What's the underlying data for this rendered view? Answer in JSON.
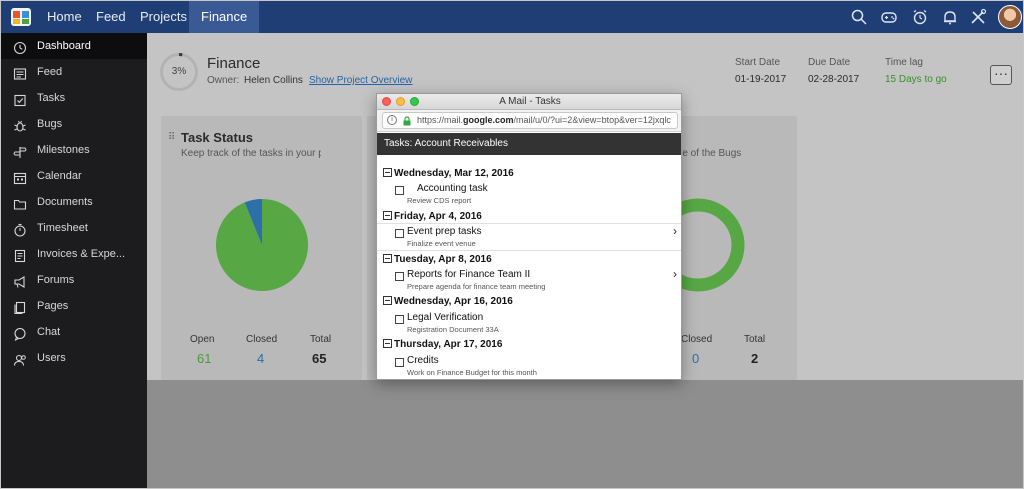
{
  "colors": {
    "topbar": "#1f3e75",
    "sidebar": "#1c1c1e",
    "open": "#4e9a3a",
    "closed": "#2a6ea8",
    "accent_green": "#3a8f2d"
  },
  "topnav": {
    "items": [
      "Home",
      "Feed",
      "Projects",
      "Finance"
    ],
    "active": "Finance",
    "icons": [
      "search-icon",
      "gamepad-icon",
      "alarm-icon",
      "bell-icon",
      "tools-icon"
    ]
  },
  "sidebar": {
    "items": [
      {
        "label": "Dashboard",
        "icon": "clock-icon",
        "active": true
      },
      {
        "label": "Feed",
        "icon": "feed-icon"
      },
      {
        "label": "Tasks",
        "icon": "tasks-icon"
      },
      {
        "label": "Bugs",
        "icon": "bug-icon"
      },
      {
        "label": "Milestones",
        "icon": "signpost-icon"
      },
      {
        "label": "Calendar",
        "icon": "calendar-icon"
      },
      {
        "label": "Documents",
        "icon": "folder-icon"
      },
      {
        "label": "Timesheet",
        "icon": "timer-icon"
      },
      {
        "label": "Invoices & Expe...",
        "icon": "invoice-icon"
      },
      {
        "label": "Forums",
        "icon": "megaphone-icon"
      },
      {
        "label": "Pages",
        "icon": "pages-icon"
      },
      {
        "label": "Chat",
        "icon": "chat-icon"
      },
      {
        "label": "Users",
        "icon": "users-icon"
      }
    ]
  },
  "project": {
    "progress": "3%",
    "progress_value": 0.03,
    "title": "Finance",
    "owner_label": "Owner:",
    "owner_name": "Helen Collins",
    "overview_link": "Show Project Overview",
    "start_label": "Start Date",
    "start_value": "01-19-2017",
    "due_label": "Due Date",
    "due_value": "02-28-2017",
    "lag_label": "Time lag",
    "lag_value": "15 Days to go",
    "more": "···"
  },
  "task_status": {
    "title": "Task Status",
    "subtitle": "Keep track of the tasks in your p",
    "open_label": "Open",
    "open_value": "61",
    "closed_label": "Closed",
    "closed_value": "4",
    "total_label": "Total",
    "total_value": "65"
  },
  "bug_status": {
    "subtitle": "re of the Bugs",
    "closed_label": "Closed",
    "closed_value": "0",
    "total_label": "Total",
    "total_value": "2"
  },
  "popup": {
    "window_title": "A Mail - Tasks",
    "url_prefix": "https://mail.",
    "url_domain": "google.com",
    "url_suffix": "/mail/u/0/?ui=2&view=btop&ver=12jxqlc",
    "header": "Tasks: Account Receivables",
    "groups": [
      {
        "date": "Wednesday, Mar 12, 2016",
        "task": "Accounting task",
        "note": "Review CDS report",
        "chevron": false
      },
      {
        "date": "Friday, Apr 4, 2016",
        "task": "Event prep tasks",
        "note": "Finalize event venue",
        "chevron": true
      },
      {
        "date": "Tuesday, Apr 8, 2016",
        "task": "Reports for Finance Team II",
        "note": "Prepare agenda for finance team meeting",
        "chevron": true
      },
      {
        "date": "Wednesday, Apr 16, 2016",
        "task": "Legal Verification",
        "note": "Registration Document 33A",
        "chevron": false
      },
      {
        "date": "Thursday, Apr 17, 2016",
        "task": "Credits",
        "note": "Work on Finance Budget for this month",
        "chevron": false
      }
    ]
  }
}
